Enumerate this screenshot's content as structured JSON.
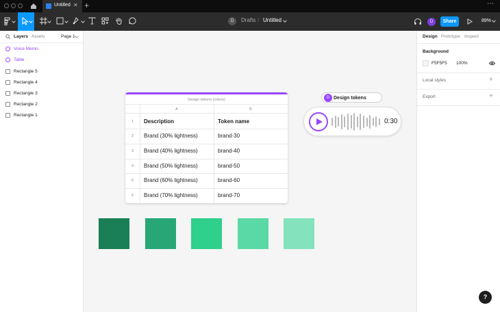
{
  "app": {
    "file_tab": "Untitled",
    "new_tab": "+",
    "more": "⋯"
  },
  "toolbar": {
    "breadcrumb_avatar": "D",
    "breadcrumb_folder": "Drafts",
    "breadcrumb_sep": "/",
    "file_name": "Untitled",
    "user_avatar": "D",
    "share_label": "Share",
    "zoom": "89%"
  },
  "left_panel": {
    "tabs": [
      "Layers",
      "Assets"
    ],
    "page": "Page 1",
    "layers": [
      {
        "name": "Voice Memo",
        "type": "component"
      },
      {
        "name": "Table",
        "type": "component"
      },
      {
        "name": "Rectangle 5",
        "type": "rectangle"
      },
      {
        "name": "Rectangle 4",
        "type": "rectangle"
      },
      {
        "name": "Rectangle 3",
        "type": "rectangle"
      },
      {
        "name": "Rectangle 2",
        "type": "rectangle"
      },
      {
        "name": "Rectangle 1",
        "type": "rectangle"
      }
    ]
  },
  "right_panel": {
    "tabs": [
      "Design",
      "Prototype",
      "Inspect"
    ],
    "background_title": "Background",
    "background_hex": "F5F5F5",
    "background_opacity": "100%",
    "local_styles": "Local styles",
    "export": "Export"
  },
  "table": {
    "title": "Design tokens (colors)",
    "columns": [
      "A",
      "B"
    ],
    "rows": [
      {
        "num": "1",
        "a": "Description",
        "b": "Token name",
        "header": true
      },
      {
        "num": "2",
        "a": "Brand (30% lightness)",
        "b": "brand-30"
      },
      {
        "num": "3",
        "a": "Brand (40% lightness)",
        "b": "brand-40"
      },
      {
        "num": "4",
        "a": "Brand (50% lightness)",
        "b": "brand-50"
      },
      {
        "num": "5",
        "a": "Brand (60% lightness)",
        "b": "brand-60"
      },
      {
        "num": "6",
        "a": "Brand (70% lightness)",
        "b": "brand-70"
      }
    ]
  },
  "voice_memo": {
    "chip_avatar": "D",
    "chip_label": "Design tokens",
    "time": "0:30",
    "wave_levels": [
      0.45,
      0.7,
      0.55,
      0.85,
      0.65,
      0.95,
      0.75,
      1.0,
      0.6,
      0.9,
      0.7,
      0.5,
      0.8,
      0.45,
      0.6,
      0.4
    ]
  },
  "swatches": [
    "#1a7f56",
    "#27a676",
    "#2fcf8c",
    "#5ad8a6",
    "#84e2bc"
  ],
  "colors": {
    "accent": "#0d99ff",
    "component": "#9747ff",
    "canvas": "#f5f5f5"
  },
  "help": "?"
}
